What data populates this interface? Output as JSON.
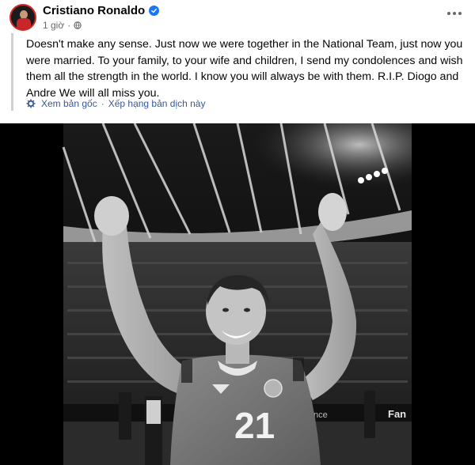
{
  "post": {
    "author": "Cristiano Ronaldo",
    "time": "1 giờ",
    "separator": "·",
    "text": "Doesn't make any sense. Just now we were together in the National Team, just now you were married. To your family, to your wife and children, I send my condolences and wish them all the strength in the world. I know you will always be with them. R.I.P. Diogo and Andre We will all miss you.",
    "see_original": "Xem bản gốc",
    "rate_translation": "Xếp hạng bản dịch này"
  },
  "photo": {
    "jersey_number": "21",
    "board_text": "Fan",
    "board_text_left": "nce"
  },
  "colors": {
    "accent": "#1877f2",
    "link": "#385898",
    "muted": "#65676b"
  },
  "icons": [
    "verified-icon",
    "globe-icon",
    "more-icon",
    "settings-icon"
  ]
}
